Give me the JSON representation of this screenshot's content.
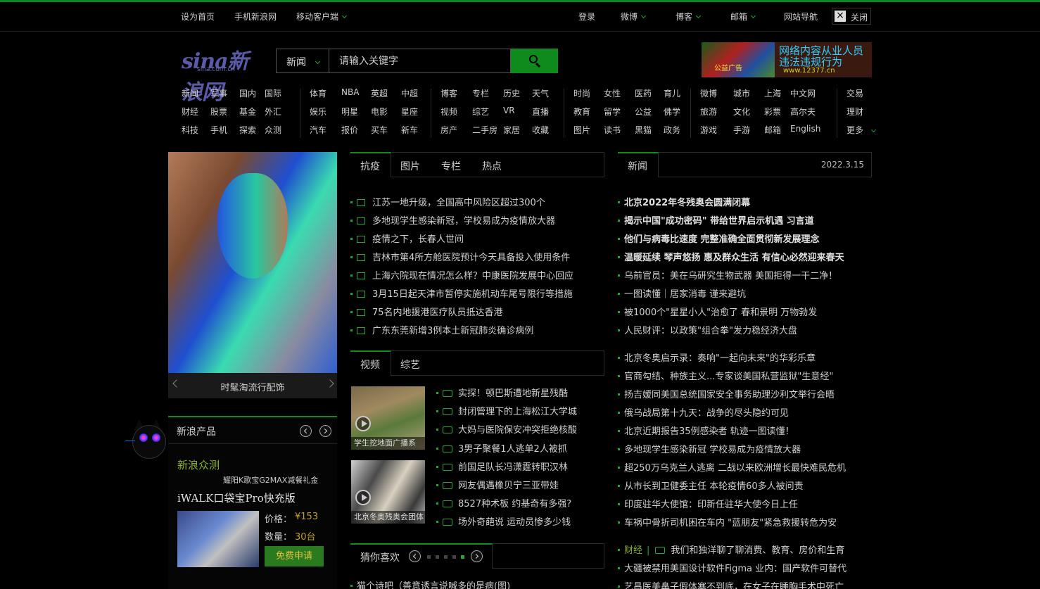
{
  "topbar": {
    "set_home": "设为首页",
    "mobile_sina": "手机新浪网",
    "mobile_client": "移动客户端",
    "login": "登录",
    "weibo": "微博",
    "blog": "博客",
    "mail": "邮箱",
    "site_nav": "网站导航",
    "close_label": "关闭",
    "close_x": "×"
  },
  "logo": {
    "main": "sina新浪网",
    "domain": "sina.com.cn"
  },
  "search": {
    "category": "新闻",
    "placeholder": "请输入关键字"
  },
  "ad": {
    "line1": "网络内容从业人员",
    "line2": "违法违规行为",
    "line3": "www.12377.cn",
    "badge": "公益广告"
  },
  "nav": {
    "groups": [
      [
        [
          "新闻",
          "军事",
          "国内",
          "国际"
        ],
        [
          "财经",
          "股票",
          "基金",
          "外汇"
        ],
        [
          "科技",
          "手机",
          "探索",
          "众测"
        ]
      ],
      [
        [
          "体育",
          "NBA",
          "英超",
          "中超"
        ],
        [
          "娱乐",
          "明星",
          "电影",
          "星座"
        ],
        [
          "汽车",
          "报价",
          "买车",
          "新车"
        ]
      ],
      [
        [
          "博客",
          "专栏",
          "历史",
          "天气"
        ],
        [
          "视频",
          "综艺",
          "VR",
          "直播"
        ],
        [
          "房产",
          "二手房",
          "家居",
          "收藏"
        ]
      ],
      [
        [
          "时尚",
          "女性",
          "医药",
          "育儿"
        ],
        [
          "教育",
          "留学",
          "公益",
          "佛学"
        ],
        [
          "图片",
          "读书",
          "黑猫",
          "政务"
        ]
      ],
      [
        [
          "微博",
          "城市",
          "上海",
          "中文网"
        ],
        [
          "旅游",
          "文化",
          "彩票",
          "高尔夫"
        ],
        [
          "游戏",
          "手游",
          "邮箱",
          "English"
        ]
      ],
      [
        [
          "交易"
        ],
        [
          "理财"
        ],
        [
          "更多"
        ]
      ]
    ]
  },
  "feature": {
    "caption": "时髦淘流行配饰"
  },
  "tabs_mid": {
    "items": [
      "抗疫",
      "图片",
      "专栏",
      "热点"
    ]
  },
  "mid_news": [
    "江苏一地升级，全国高中风险区超过300个",
    "多地现学生感染新冠，学校易成为疫情放大器",
    "疫情之下，长春人世间",
    "吉林市第4所方舱医院预计今天具备投入使用条件",
    "上海六院现在情况怎么样？中康医院发展中心回应",
    "3月15日起天津市暂停实施机动车尾号限行等措施",
    "75名内地援港医疗队员抵达香港",
    "广东东莞新增3例本土新冠肺炎确诊病例"
  ],
  "tabs_video": {
    "items": [
      "视频",
      "综艺"
    ]
  },
  "video_thumbs": [
    {
      "label": "学生挖地面广播系"
    },
    {
      "label": "北京冬奥残奥会团体"
    }
  ],
  "video_news": [
    "实探！顿巴斯遭地新星残酷",
    "封闭管理下的上海松江大学城",
    "大妈与医院保安冲突拒绝核酸",
    "3男子聚餐1人逃单2人被抓",
    "前国足队长冯潇霆转职汉林",
    "网友偶遇橡贝宁三亚带娃",
    "8527种术板 约基奇有多强?",
    "场外奇葩说 运动员惨多少钱"
  ],
  "guess": {
    "title": "猜你喜欢",
    "first_item": "猫个诗吧（善意诱言说喊多的是病(图)"
  },
  "right_tab": {
    "label": "新闻",
    "date": "2022.3.15"
  },
  "right_news_a": [
    "北京2022年冬残奥会圆满闭幕",
    "揭示中国\"成功密码\" 带给世界启示机遇 习言道",
    "他们与病毒比速度 完整准确全面贯彻新发展理念",
    "温暖延续 琴声悠扬 惠及群众生活 有信心必然迎来春天",
    "乌前官员：美在乌研究生物武器 美国拒得一干二净！",
    "一图读懂｜居家消毒 谨来避坑",
    "被1000个\"星星小人\"治愈了 春和景明 万物勃发",
    "人民财评：以政策\"组合拳\"发力稳经济大盘"
  ],
  "right_news_b": [
    "北京冬奥启示录：奏响\"一起向未来\"的华彩乐章",
    "官商勾结、种族主义...专家谈美国私营监狱\"生意经\"",
    "扬吉嫒同美国总统国家安全事务助理沙利文举行会晤",
    "俄乌战局第十九天：战争的尽头隐约可见",
    "北京近期报告35例感染者 轨迹一图读懂！",
    "多地现学生感染新冠 学校易成为疫情放大器",
    "超250万乌克兰人逃离 二战以来欧洲增长最快难民危机",
    "从市长到卫健委主任 本轮疫情60多人被问责",
    "印度驻华大使馆：印新任驻华大使今日上任",
    "车祸中骨折司机困在车内 \"蓝朋友\"紧急救援转危为安"
  ],
  "right_news_c": {
    "tag": "财经",
    "first": "我们和独洋聊了聊消费、教育、房价和生育",
    "items": [
      "大疆被禁用美国设计软件Figma 业内：国产软件可替代",
      "艺昌医美鼻子假体塞不到底，在女子在睡胸手术中死亡"
    ]
  },
  "product": {
    "header": "新浪产品",
    "zhongce": "新浪众测",
    "sub": "耀阳K歌宝G2MAX减餐礼金",
    "name": "iWALK口袋宝Pro快充版",
    "price_label": "价格：",
    "price_value": "¥153",
    "qty_label": "数量：",
    "qty_value": "30台",
    "apply": "免费申请"
  },
  "colors": {
    "accent": "#0f8a1c",
    "link_blue": "#4a78d0"
  }
}
